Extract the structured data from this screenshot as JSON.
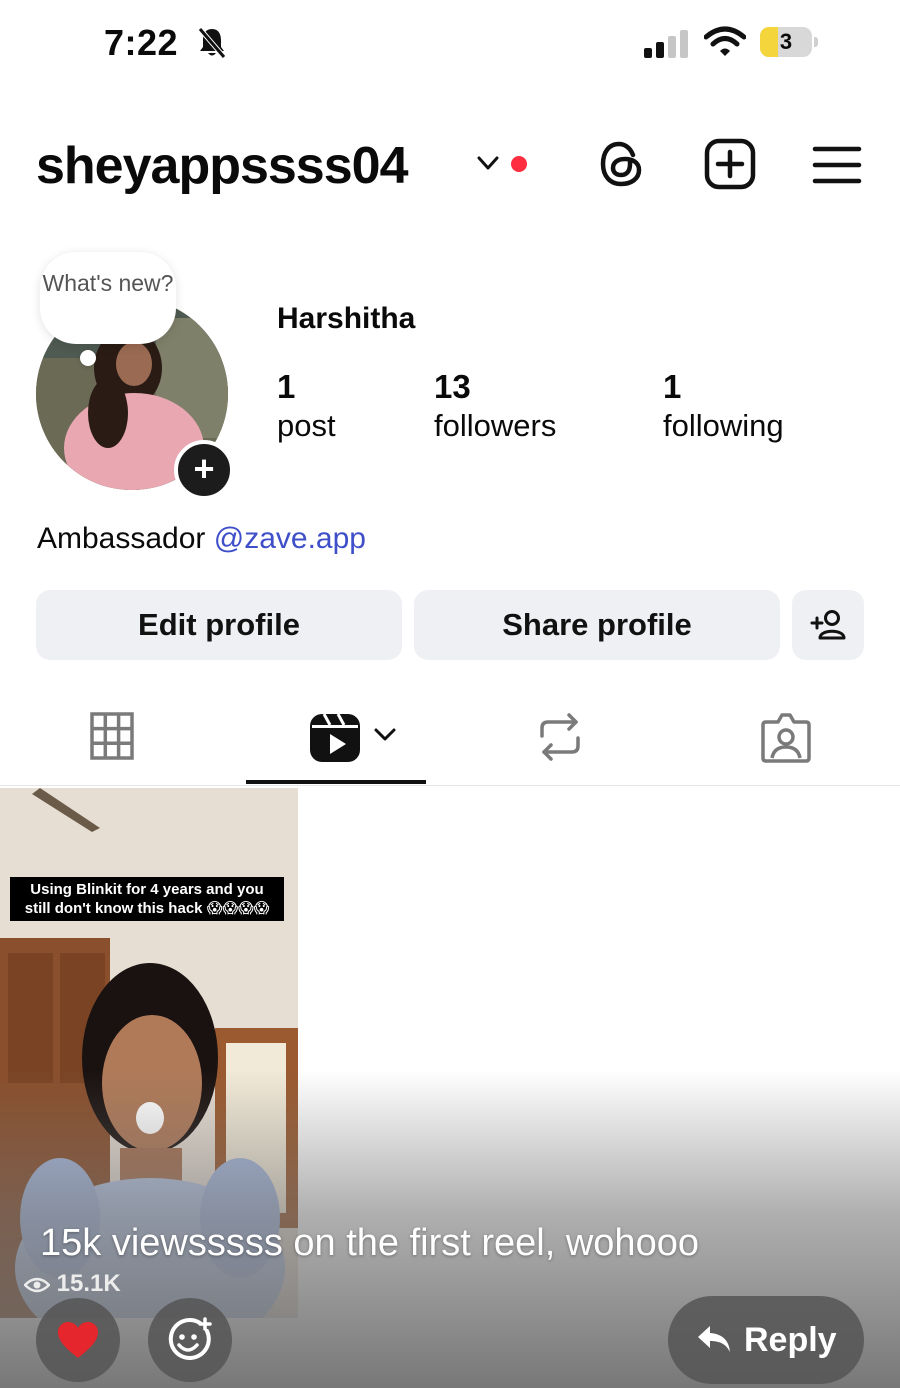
{
  "status_bar": {
    "time": "7:22",
    "battery_level": "3",
    "icons": [
      "bell-slash-icon",
      "signal-icon",
      "wifi-icon",
      "battery-icon"
    ]
  },
  "header": {
    "username": "sheyappssss04",
    "icons": [
      "chevron-down-icon",
      "threads-icon",
      "add-post-icon",
      "menu-icon"
    ],
    "notification_dot_color": "#ff2d40"
  },
  "profile": {
    "note_bubble": "What's new?",
    "display_name": "Harshitha",
    "stats": [
      {
        "value": "1",
        "label": "post"
      },
      {
        "value": "13",
        "label": "followers"
      },
      {
        "value": "1",
        "label": "following"
      }
    ],
    "bio_text": "Ambassador",
    "bio_link": "@zave.app",
    "bio_link_color": "#3e4fc9"
  },
  "actions": {
    "edit_profile": "Edit profile",
    "share_profile": "Share profile"
  },
  "tabs": [
    {
      "icon": "grid-icon",
      "active": false
    },
    {
      "icon": "reels-icon",
      "active": true
    },
    {
      "icon": "reposts-icon",
      "active": false
    },
    {
      "icon": "tagged-icon",
      "active": false
    }
  ],
  "reel": {
    "caption_line1": "Using Blinkit for 4 years and you",
    "caption_line2": "still don't know this hack",
    "caption_emoji": "😱😱😱😱",
    "views": "15.1K"
  },
  "story_overlay": {
    "text": "15k viewsssss on the first reel, wohooo",
    "reply_label": "Reply",
    "react_icons": [
      "heart-icon",
      "emoji-add-icon"
    ]
  }
}
